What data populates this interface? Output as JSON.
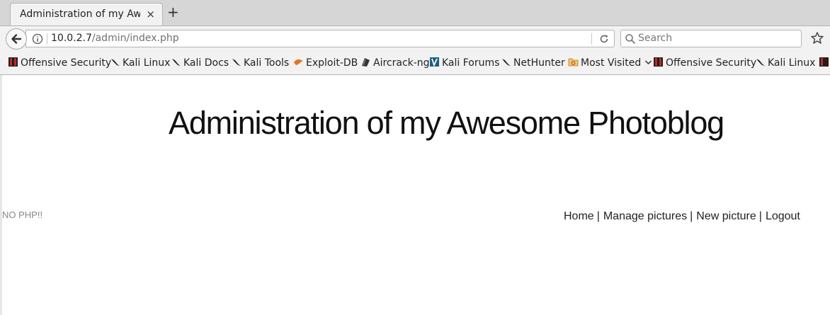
{
  "browser": {
    "tab_title": "Administration of my Awe…",
    "tab_close": "×",
    "new_tab": "+",
    "url_host": "10.0.2.7",
    "url_path": "/admin/index.php",
    "search_placeholder": "Search"
  },
  "bookmarks": [
    {
      "label": "Offensive Security",
      "icon": "offsec-icon"
    },
    {
      "label": "Kali Linux",
      "icon": "kali-dragon-icon"
    },
    {
      "label": "Kali Docs",
      "icon": "kali-dragon-icon"
    },
    {
      "label": "Kali Tools",
      "icon": "kali-dragon-icon"
    },
    {
      "label": "Exploit-DB",
      "icon": "exploitdb-icon"
    },
    {
      "label": "Aircrack-ng",
      "icon": "aircrack-icon"
    },
    {
      "label": "Kali Forums",
      "icon": "kali-forums-icon"
    },
    {
      "label": "NetHunter",
      "icon": "kali-dragon-icon"
    },
    {
      "label": "Most Visited",
      "icon": "folder-icon"
    },
    {
      "label": "Offensive Security",
      "icon": "offsec-icon"
    },
    {
      "label": "Kali Linux",
      "icon": "kali-dragon-icon"
    }
  ],
  "page": {
    "title": "Administration of my Awesome Photoblog",
    "notice": "NO PHP!!",
    "menu": {
      "home": "Home",
      "manage": "Manage pictures",
      "new": "New picture",
      "logout": "Logout",
      "separator": "|"
    }
  }
}
